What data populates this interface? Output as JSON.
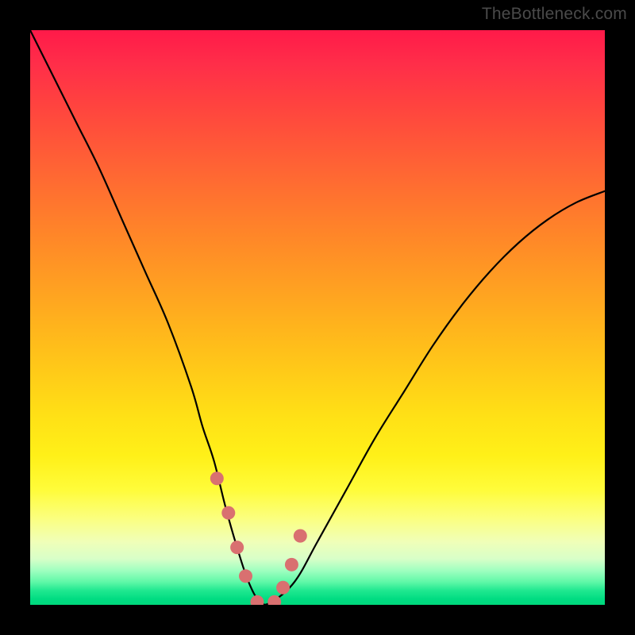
{
  "watermark": "TheBottleneck.com",
  "chart_data": {
    "type": "line",
    "title": "",
    "xlabel": "",
    "ylabel": "",
    "xlim": [
      0,
      100
    ],
    "ylim": [
      0,
      100
    ],
    "grid": false,
    "series": [
      {
        "name": "bottleneck-curve",
        "x": [
          0,
          4,
          8,
          12,
          16,
          20,
          24,
          28,
          30,
          32,
          34,
          36,
          38,
          40,
          42,
          46,
          50,
          55,
          60,
          65,
          70,
          75,
          80,
          85,
          90,
          95,
          100
        ],
        "values": [
          100,
          92,
          84,
          76,
          67,
          58,
          49,
          38,
          31,
          25,
          17,
          10,
          4,
          0.5,
          0.5,
          4,
          11,
          20,
          29,
          37,
          45,
          52,
          58,
          63,
          67,
          70,
          72
        ]
      }
    ],
    "markers": {
      "name": "highlighted-points",
      "x": [
        32.5,
        34.5,
        36,
        37.5,
        39.5,
        42.5,
        44,
        45.5,
        47
      ],
      "values": [
        22,
        16,
        10,
        5,
        0.5,
        0.5,
        3,
        7,
        12
      ],
      "color": "#d97070"
    },
    "background_gradient": {
      "top": "#ff1a49",
      "mid": "#ffe016",
      "bottom": "#00d87c"
    }
  }
}
